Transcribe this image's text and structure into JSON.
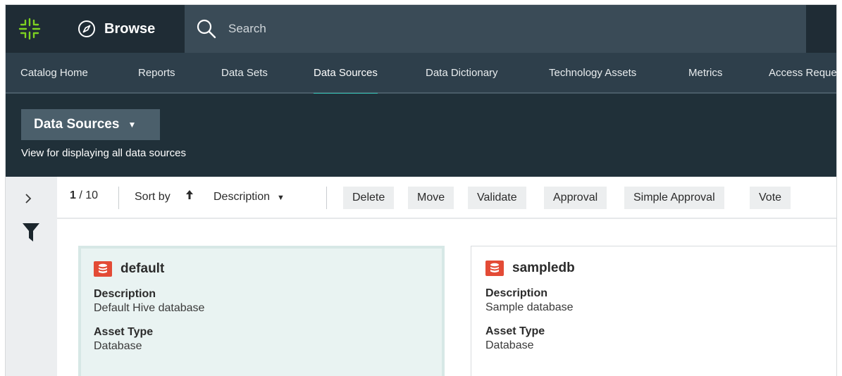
{
  "topbar": {
    "browse_label": "Browse",
    "search_placeholder": "Search"
  },
  "nav": {
    "tabs": [
      {
        "label": "Catalog Home"
      },
      {
        "label": "Reports"
      },
      {
        "label": "Data Sets"
      },
      {
        "label": "Data Sources",
        "active": true
      },
      {
        "label": "Data Dictionary"
      },
      {
        "label": "Technology Assets"
      },
      {
        "label": "Metrics"
      },
      {
        "label": "Access Reque"
      }
    ]
  },
  "header": {
    "view_label": "Data Sources",
    "view_description": "View for displaying all data sources"
  },
  "toolbar": {
    "page_current": "1",
    "page_sep": " / ",
    "page_total": "10",
    "sort_by_label": "Sort by",
    "sort_field": "Description",
    "buttons": [
      "Delete",
      "Move",
      "Validate",
      "Approval",
      "Simple Approval",
      "Vote"
    ]
  },
  "cards": [
    {
      "title": "default",
      "description_label": "Description",
      "description_value": "Default Hive database",
      "asset_type_label": "Asset Type",
      "asset_type_value": "Database"
    },
    {
      "title": "sampledb",
      "description_label": "Description",
      "description_value": "Sample database",
      "asset_type_label": "Asset Type",
      "asset_type_value": "Database"
    }
  ],
  "colors": {
    "topbar_bg": "#2e3f4b",
    "header_bg": "#203039",
    "accent_teal": "#36c1b4",
    "logo_green": "#7ed321",
    "db_icon_red": "#e34b36"
  },
  "icons": {
    "logo": "logo-icon",
    "browse": "compass-icon",
    "search": "search-icon",
    "expand": "chevron-right-icon",
    "filter": "filter-icon",
    "sort": "arrow-up-icon",
    "database": "database-icon"
  }
}
